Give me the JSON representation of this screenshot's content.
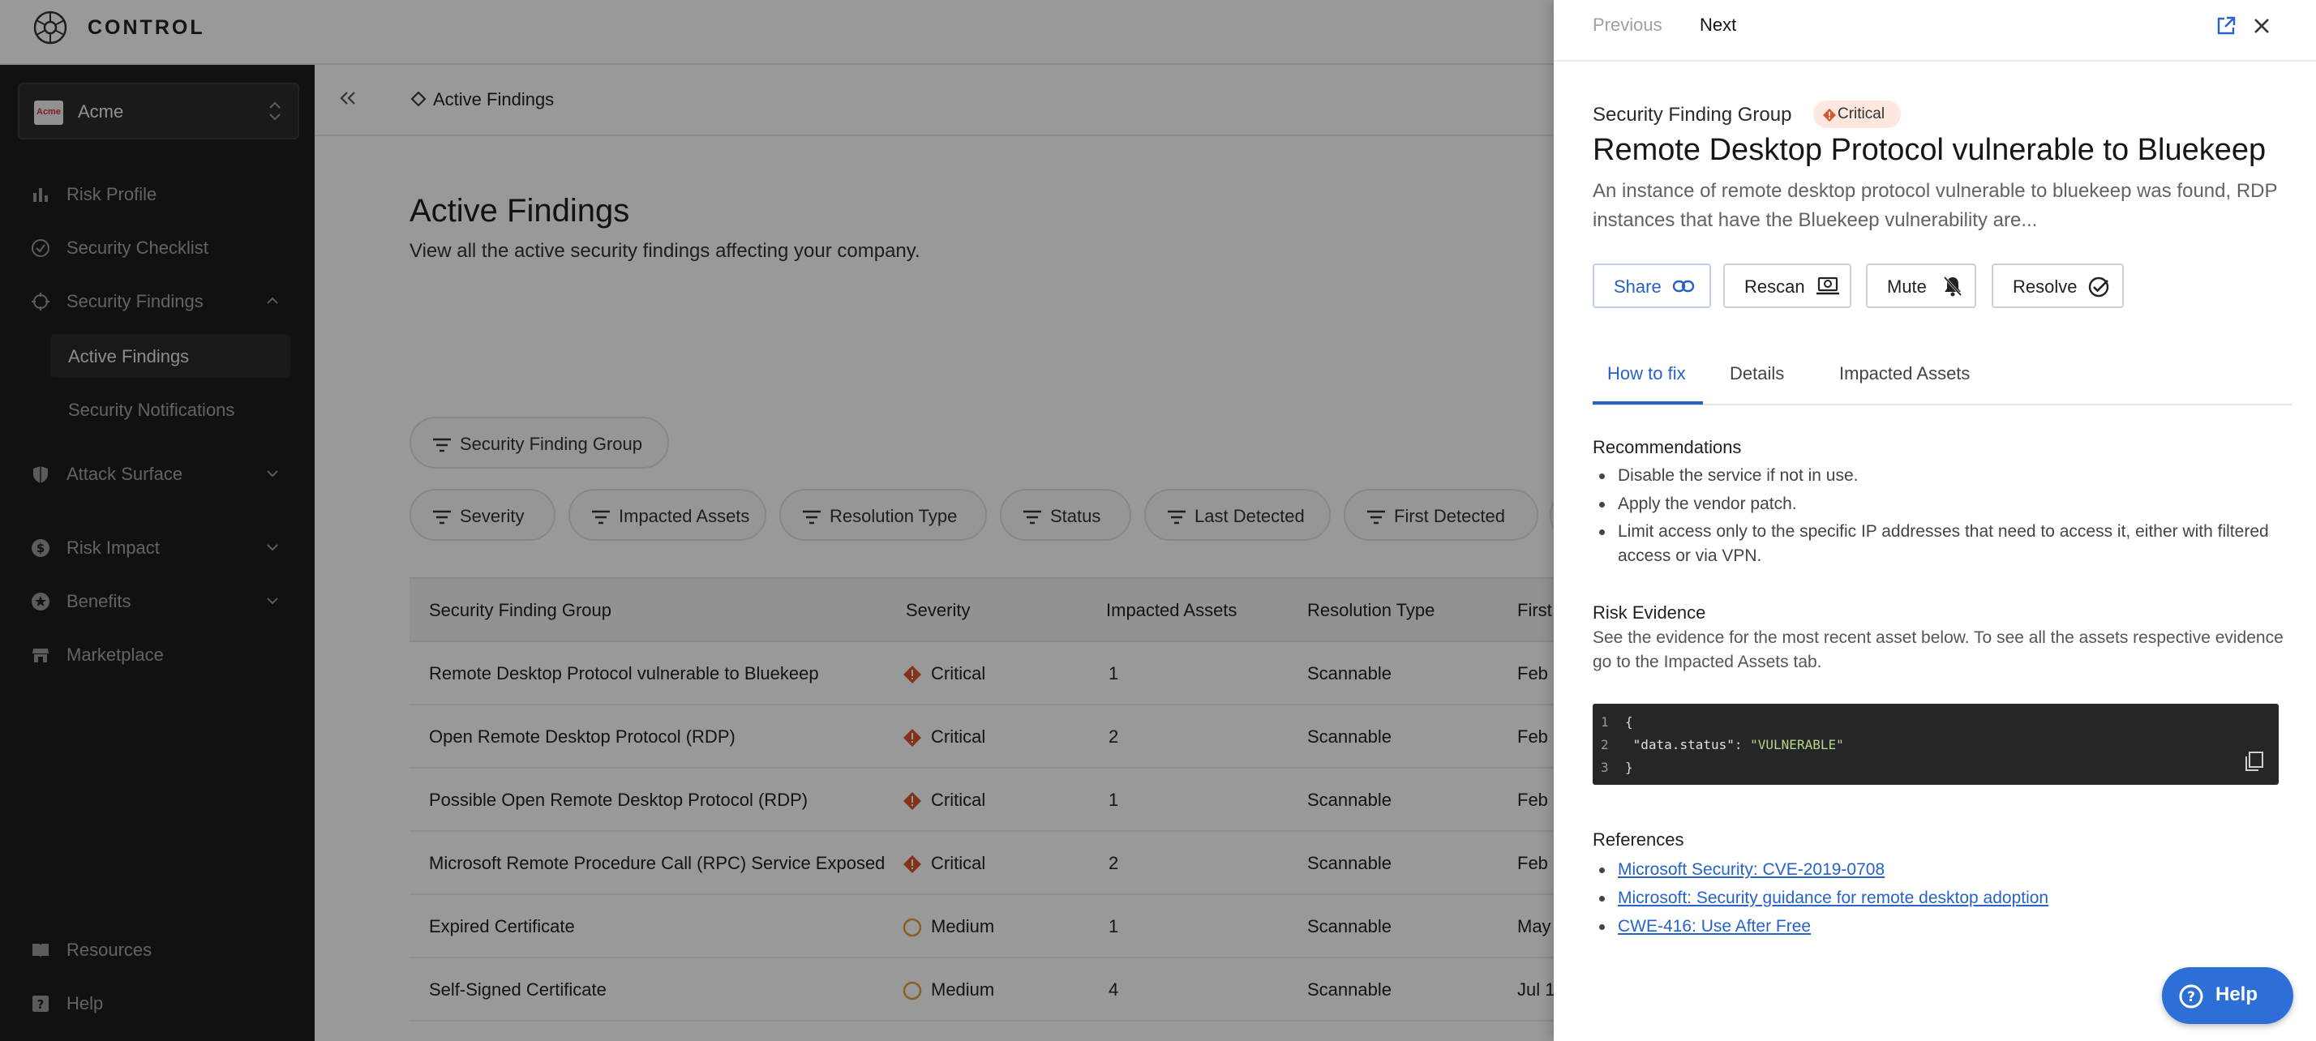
{
  "brand": {
    "name": "CONTROL"
  },
  "sidebar": {
    "org_name": "Acme",
    "org_logo_text": "Acme",
    "items": [
      {
        "label": "Risk Profile",
        "icon": "bar-chart-icon"
      },
      {
        "label": "Security Checklist",
        "icon": "check-circle-icon"
      },
      {
        "label": "Security Findings",
        "icon": "crosshair-icon",
        "expanded": true
      },
      {
        "label": "Active Findings",
        "sub": true,
        "active": true
      },
      {
        "label": "Security Notifications",
        "sub": true
      },
      {
        "label": "Attack Surface",
        "icon": "shield-icon"
      },
      {
        "label": "Risk Impact",
        "icon": "dollar-icon"
      },
      {
        "label": "Benefits",
        "icon": "star-badge-icon"
      },
      {
        "label": "Marketplace",
        "icon": "store-icon"
      }
    ],
    "footer": [
      {
        "label": "Resources",
        "icon": "book-icon"
      },
      {
        "label": "Help",
        "icon": "help-square-icon"
      }
    ]
  },
  "main": {
    "breadcrumb": "Active Findings",
    "title": "Active Findings",
    "subtitle": "View all the active security findings affecting your company.",
    "group_filter": "Security Finding Group",
    "filters": [
      "Severity",
      "Impacted Assets",
      "Resolution Type",
      "Status",
      "Last Detected",
      "First Detected"
    ],
    "table": {
      "columns": [
        "Security Finding Group",
        "Severity",
        "Impacted Assets",
        "Resolution Type",
        "First"
      ],
      "rows": [
        {
          "group": "Remote Desktop Protocol vulnerable to Bluekeep",
          "severity": "Critical",
          "assets": "1",
          "resolution": "Scannable",
          "first": "Feb"
        },
        {
          "group": "Open Remote Desktop Protocol (RDP)",
          "severity": "Critical",
          "assets": "2",
          "resolution": "Scannable",
          "first": "Feb"
        },
        {
          "group": "Possible Open Remote Desktop Protocol (RDP)",
          "severity": "Critical",
          "assets": "1",
          "resolution": "Scannable",
          "first": "Feb"
        },
        {
          "group": "Microsoft Remote Procedure Call (RPC) Service Exposed",
          "severity": "Critical",
          "assets": "2",
          "resolution": "Scannable",
          "first": "Feb"
        },
        {
          "group": "Expired Certificate",
          "severity": "Medium",
          "assets": "1",
          "resolution": "Scannable",
          "first": "May"
        },
        {
          "group": "Self-Signed Certificate",
          "severity": "Medium",
          "assets": "4",
          "resolution": "Scannable",
          "first": "Jul 1"
        }
      ]
    }
  },
  "panel": {
    "prev_label": "Previous",
    "next_label": "Next",
    "kind": "Security Finding Group",
    "severity": "Critical",
    "title": "Remote Desktop Protocol vulnerable to Bluekeep",
    "description": "An instance of remote desktop protocol vulnerable to bluekeep was found, RDP instances that have the Bluekeep vulnerability are...",
    "actions": {
      "share": "Share",
      "rescan": "Rescan",
      "mute": "Mute",
      "resolve": "Resolve"
    },
    "tabs": [
      "How to fix",
      "Details",
      "Impacted Assets"
    ],
    "recommendations_title": "Recommendations",
    "recommendations": [
      "Disable the service if not in use.",
      "Apply the vendor patch.",
      "Limit access only to the specific IP addresses that need to access it, either with filtered access or via VPN."
    ],
    "evidence_title": "Risk Evidence",
    "evidence_text": "See the evidence for the most recent asset below. To see all the assets respective evidence go to the Impacted Assets tab.",
    "code": {
      "line1": "{",
      "key": "\"data.status\"",
      "sep": ": ",
      "value": "\"VULNERABLE\"",
      "line3": "}"
    },
    "references_title": "References",
    "references": [
      "Microsoft Security: CVE-2019-0708",
      "Microsoft: Security guidance for remote desktop adoption",
      "CWE-416: Use After Free"
    ]
  },
  "help_button": "Help",
  "colors": {
    "accent": "#2563c9",
    "critical": "#d9552b",
    "medium": "#e0a23b",
    "sidebar_bg": "#1d1d1f"
  }
}
